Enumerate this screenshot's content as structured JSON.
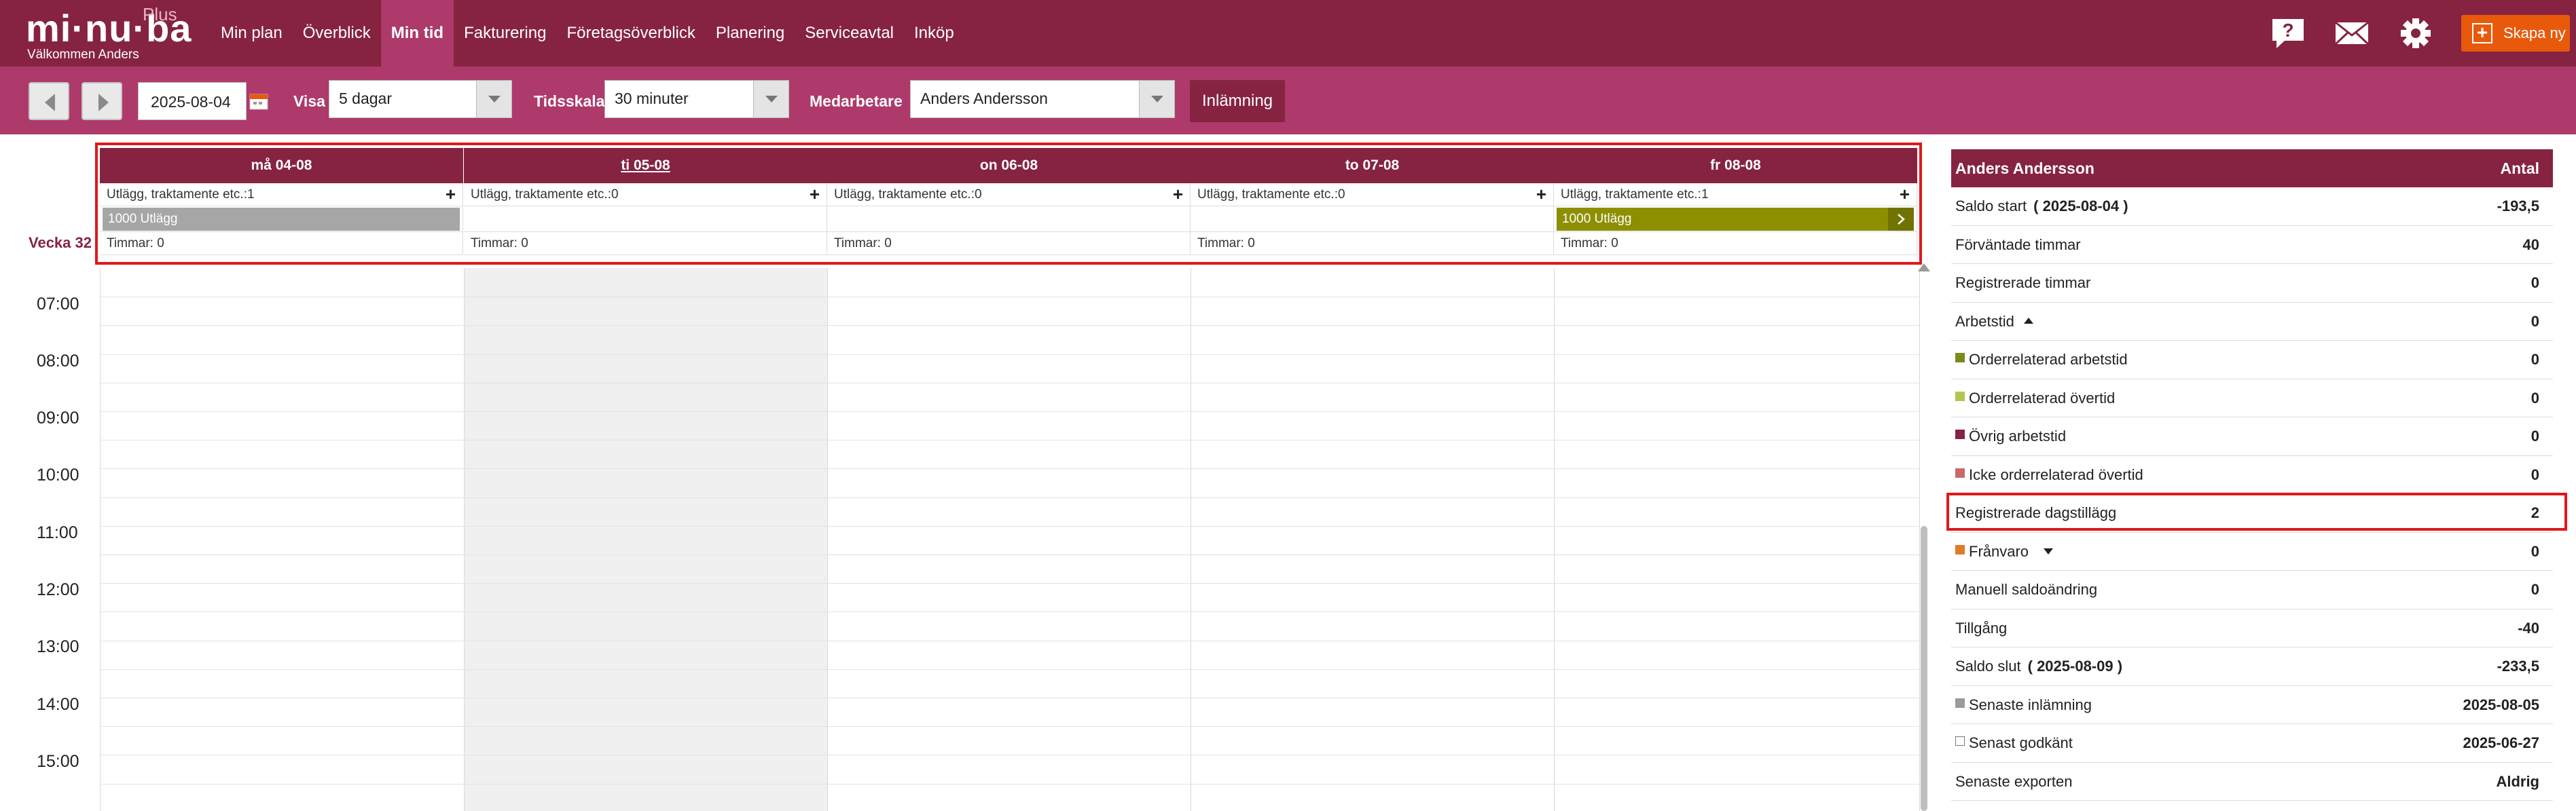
{
  "app": {
    "logo_text": "mi·nu·ba",
    "logo_plus": "Plus",
    "welcome": "Välkommen Anders"
  },
  "nav": {
    "items": [
      {
        "label": "Min plan"
      },
      {
        "label": "Överblick"
      },
      {
        "label": "Min tid",
        "active": true
      },
      {
        "label": "Fakturering"
      },
      {
        "label": "Företagsöverblick"
      },
      {
        "label": "Planering"
      },
      {
        "label": "Serviceavtal"
      },
      {
        "label": "Inköp"
      }
    ],
    "icons": [
      "help-icon",
      "mail-icon",
      "gear-icon"
    ],
    "create_label": "Skapa ny"
  },
  "toolbar": {
    "date": "2025-08-04",
    "show_label": "Visa",
    "show_value": "5 dagar",
    "scale_label": "Tidsskala",
    "scale_value": "30 minuter",
    "employee_label": "Medarbetare",
    "employee_value": "Anders Andersson",
    "submit_label": "Inlämning"
  },
  "calendar": {
    "week_label": "Vecka 32",
    "days": [
      {
        "label": "må 04-08",
        "expense_row": "Utlägg, traktamente etc.:1",
        "entry": "1000 Utlägg",
        "entry_color": "#a6a6a6",
        "hours": "Timmar: 0",
        "today": false
      },
      {
        "label": "ti 05-08",
        "expense_row": "Utlägg, traktamente etc.:0",
        "entry": "",
        "entry_color": "",
        "hours": "Timmar: 0",
        "today": true
      },
      {
        "label": "on 06-08",
        "expense_row": "Utlägg, traktamente etc.:0",
        "entry": "",
        "entry_color": "",
        "hours": "Timmar: 0",
        "today": false
      },
      {
        "label": "to 07-08",
        "expense_row": "Utlägg, traktamente etc.:0",
        "entry": "",
        "entry_color": "",
        "hours": "Timmar: 0",
        "today": false
      },
      {
        "label": "fr 08-08",
        "expense_row": "Utlägg, traktamente etc.:1",
        "entry": "1000 Utlägg",
        "entry_color": "#8d8f00",
        "hours": "Timmar: 0",
        "today": false
      }
    ],
    "times": [
      "07:00",
      "08:00",
      "09:00",
      "10:00",
      "11:00",
      "12:00",
      "13:00",
      "14:00",
      "15:00"
    ]
  },
  "summary": {
    "header_name": "Anders Andersson",
    "header_col": "Antal",
    "rows": [
      {
        "label": "Saldo start",
        "date": "( 2025-08-04 )",
        "value": "-193,5"
      },
      {
        "label": "Förväntade timmar",
        "value": "40"
      },
      {
        "label": "Registrerade timmar",
        "value": "0"
      },
      {
        "label": "Arbetstid",
        "value": "0",
        "caret": "up"
      },
      {
        "label": "Orderrelaterad arbetstid",
        "value": "0",
        "swatch": "#7c8a1a"
      },
      {
        "label": "Orderrelaterad övertid",
        "value": "0",
        "swatch": "#b5c451"
      },
      {
        "label": "Övrig arbetstid",
        "value": "0",
        "swatch": "#862341"
      },
      {
        "label": "Icke orderrelaterad övertid",
        "value": "0",
        "swatch": "#c96a6a"
      },
      {
        "label": "Registrerade dagstillägg",
        "value": "2",
        "highlight": true
      },
      {
        "label": "Frånvaro",
        "value": "0",
        "swatch": "#e07b2a",
        "caret": "down"
      },
      {
        "label": "Manuell saldoändring",
        "value": "0"
      },
      {
        "label": "Tillgång",
        "value": "-40"
      },
      {
        "label": "Saldo slut",
        "date": "( 2025-08-09 )",
        "value": "-233,5"
      },
      {
        "label": "Senaste inlämning",
        "value": "2025-08-05",
        "swatch": "#9a9a9a"
      },
      {
        "label": "Senast godkänt",
        "value": "2025-06-27",
        "swatch": "outline"
      },
      {
        "label": "Senaste exporten",
        "value": "Aldrig"
      }
    ]
  }
}
